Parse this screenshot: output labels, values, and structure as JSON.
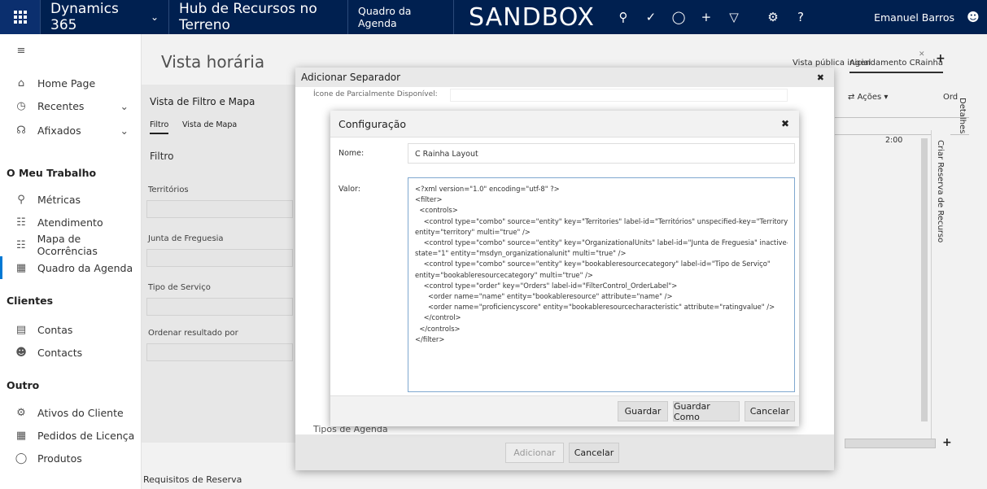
{
  "topbar": {
    "app": "Dynamics 365",
    "area": "Hub de Recursos no Terreno",
    "page": "Quadro da Agenda",
    "env": "SANDBOX",
    "user": "Emanuel Barros",
    "icons": [
      "search-icon",
      "task-icon",
      "lightbulb-icon",
      "plus-icon",
      "filter-icon",
      "settings-icon",
      "help-icon",
      "user-icon"
    ]
  },
  "sidebar": {
    "home": "Home Page",
    "recent": "Recentes",
    "pinned": "Afixados",
    "section_work": "O Meu Trabalho",
    "work_items": [
      "Métricas",
      "Atendimento",
      "Mapa de Ocorrências",
      "Quadro da Agenda"
    ],
    "section_clients": "Clientes",
    "client_items": [
      "Contas",
      "Contacts"
    ],
    "section_other": "Outro",
    "other_items": [
      "Ativos do Cliente",
      "Pedidos de Licença",
      "Produtos"
    ]
  },
  "main": {
    "title": "Vista horária",
    "public_view": "Vista pública inicial",
    "tab_active": "Agendamento CRainha",
    "filter_title": "Vista de Filtro e Mapa",
    "tab_filter": "Filtro",
    "tab_map": "Vista de Mapa",
    "filter_head": "Filtro",
    "fields": [
      "Territórios",
      "Junta de Freguesia",
      "Tipo de Serviço",
      "Ordenar resultado por"
    ],
    "actions": "Ações",
    "order": "Ord",
    "details": "Detalhes",
    "time": "2:00",
    "create_booking": "Criar Reserva de Recurso",
    "requirements": "Requisitos de Reserva"
  },
  "dialog1": {
    "title": "Adicionar Separador",
    "partial_icon": "Ícone de Parcialmente Disponível:",
    "agenda_types": "Tipos de Agenda",
    "add": "Adicionar",
    "cancel": "Cancelar"
  },
  "dialog2": {
    "title": "Configuração",
    "name_label": "Nome:",
    "name_value": "C Rainha Layout",
    "value_label": "Valor:",
    "xml_lines": [
      "<?xml version=\"1.0\" encoding=\"utf-8\" ?>",
      "<filter>",
      "  <controls>",
      "    <control type=\"combo\" source=\"entity\" key=\"Territories\" label-id=\"Territórios\" unspecified-key=\"Territory\"",
      "entity=\"territory\" multi=\"true\" />",
      "    <control type=\"combo\" source=\"entity\" key=\"OrganizationalUnits\" label-id=\"Junta de Freguesia\" inactive-",
      "state=\"1\" entity=\"msdyn_organizationalunit\" multi=\"true\" />",
      "    <control type=\"combo\" source=\"entity\" key=\"bookableresourcecategory\" label-id=\"Tipo de Serviço\"",
      "entity=\"bookableresourcecategory\" multi=\"true\" />",
      "    <control type=\"order\" key=\"Orders\" label-id=\"FilterControl_OrderLabel\">",
      "      <order name=\"name\" entity=\"bookableresource\" attribute=\"name\" />",
      "      <order name=\"proficiencyscore\" entity=\"bookableresourcecharacteristic\" attribute=\"ratingvalue\" />",
      "    </control>",
      "  </controls>",
      "</filter>"
    ],
    "save": "Guardar",
    "save_as": "Guardar Como",
    "cancel": "Cancelar"
  }
}
